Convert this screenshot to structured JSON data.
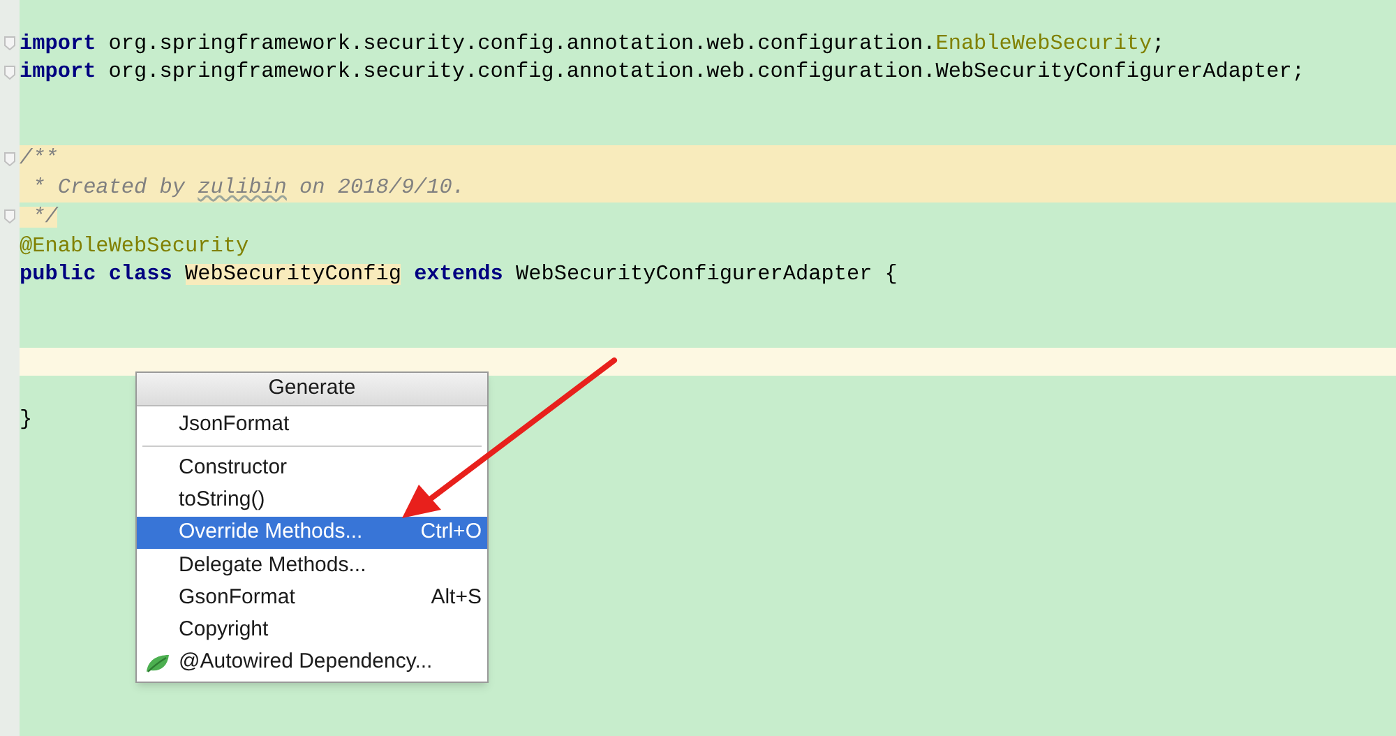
{
  "editor": {
    "lines": [
      {
        "kind": "code",
        "tokens": [
          {
            "text": "import",
            "kind": "keyword"
          },
          {
            "text": " org.springframework.security.config.annotation.web.configuration.",
            "kind": "plain"
          },
          {
            "text": "EnableWebSecurity",
            "kind": "annotation"
          },
          {
            "text": ";",
            "kind": "plain"
          }
        ]
      },
      {
        "kind": "code",
        "tokens": [
          {
            "text": "import",
            "kind": "keyword"
          },
          {
            "text": " org.springframework.security.config.annotation.web.configuration.WebSecurityConfigurerAdapter;",
            "kind": "plain"
          }
        ]
      },
      {
        "kind": "code"
      },
      {
        "kind": "code"
      },
      {
        "kind": "doc",
        "tokens": [
          {
            "text": "/**",
            "kind": "comment"
          }
        ]
      },
      {
        "kind": "doc",
        "tokens": [
          {
            "text": " * Created by ",
            "kind": "comment"
          },
          {
            "text": "zulibin",
            "kind": "comment_typo"
          },
          {
            "text": " on 2018/9/10.",
            "kind": "comment"
          }
        ]
      },
      {
        "kind": "code",
        "tokens": [
          {
            "text": " */",
            "kind": "comment_marked"
          }
        ]
      },
      {
        "kind": "code",
        "tokens": [
          {
            "text": "@EnableWebSecurity",
            "kind": "annotation"
          }
        ]
      },
      {
        "kind": "code",
        "tokens": [
          {
            "text": "public ",
            "kind": "keyword"
          },
          {
            "text": "class ",
            "kind": "keyword"
          },
          {
            "text": "WebSecurityConfig",
            "kind": "marked"
          },
          {
            "text": " extends",
            "kind": "keyword"
          },
          {
            "text": " WebSecurityConfigurerAdapter {",
            "kind": "plain"
          }
        ]
      },
      {
        "kind": "code"
      },
      {
        "kind": "code"
      },
      {
        "kind": "caret"
      },
      {
        "kind": "code"
      },
      {
        "kind": "code",
        "tokens": [
          {
            "text": "}",
            "kind": "plain"
          }
        ]
      }
    ]
  },
  "popup": {
    "title": "Generate",
    "items": [
      {
        "kind": "item",
        "label": "JsonFormat",
        "selected": false
      },
      {
        "kind": "separator"
      },
      {
        "kind": "item",
        "label": "Constructor",
        "selected": false
      },
      {
        "kind": "item",
        "label": "toString()",
        "selected": false
      },
      {
        "kind": "item",
        "label": "Override Methods...",
        "shortcut": "Ctrl+O",
        "selected": true
      },
      {
        "kind": "item",
        "label": "Delegate Methods...",
        "selected": false
      },
      {
        "kind": "item",
        "label": "GsonFormat",
        "shortcut": "Alt+S",
        "selected": false
      },
      {
        "kind": "item",
        "label": "Copyright",
        "selected": false
      },
      {
        "kind": "leaf_item",
        "label": "@Autowired Dependency...",
        "selected": false
      }
    ]
  }
}
